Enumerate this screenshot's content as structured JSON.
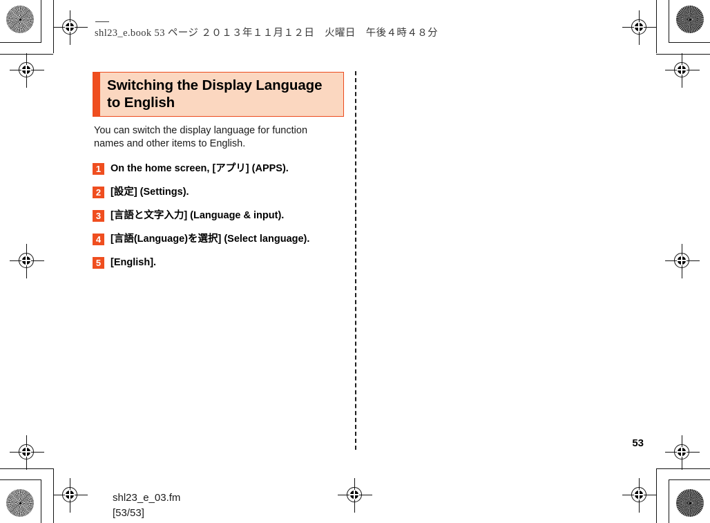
{
  "document": {
    "header_line": "shl23_e.book   53 ページ   ２０１３年１１月１２日　火曜日　午後４時４８分",
    "page_number": "53",
    "footer_filename": "shl23_e_03.fm",
    "footer_pagination": "[53/53]"
  },
  "section": {
    "title": "Switching the Display Language to English",
    "intro": "You can switch the display language for function names and other items to English."
  },
  "steps": [
    {
      "number": "1",
      "text": "On the home screen, [アプリ] (APPS)."
    },
    {
      "number": "2",
      "text": "[設定] (Settings)."
    },
    {
      "number": "3",
      "text": "[言語と文字入力] (Language & input)."
    },
    {
      "number": "4",
      "text": "[言語(Language)を選択] (Select language)."
    },
    {
      "number": "5",
      "text": "[English]."
    }
  ],
  "colors": {
    "accent_orange": "#EF4E1F",
    "title_background": "#FBD7C0",
    "title_border": "#EC4A1D",
    "text": "#000000",
    "header_text": "#3A3A3A"
  }
}
